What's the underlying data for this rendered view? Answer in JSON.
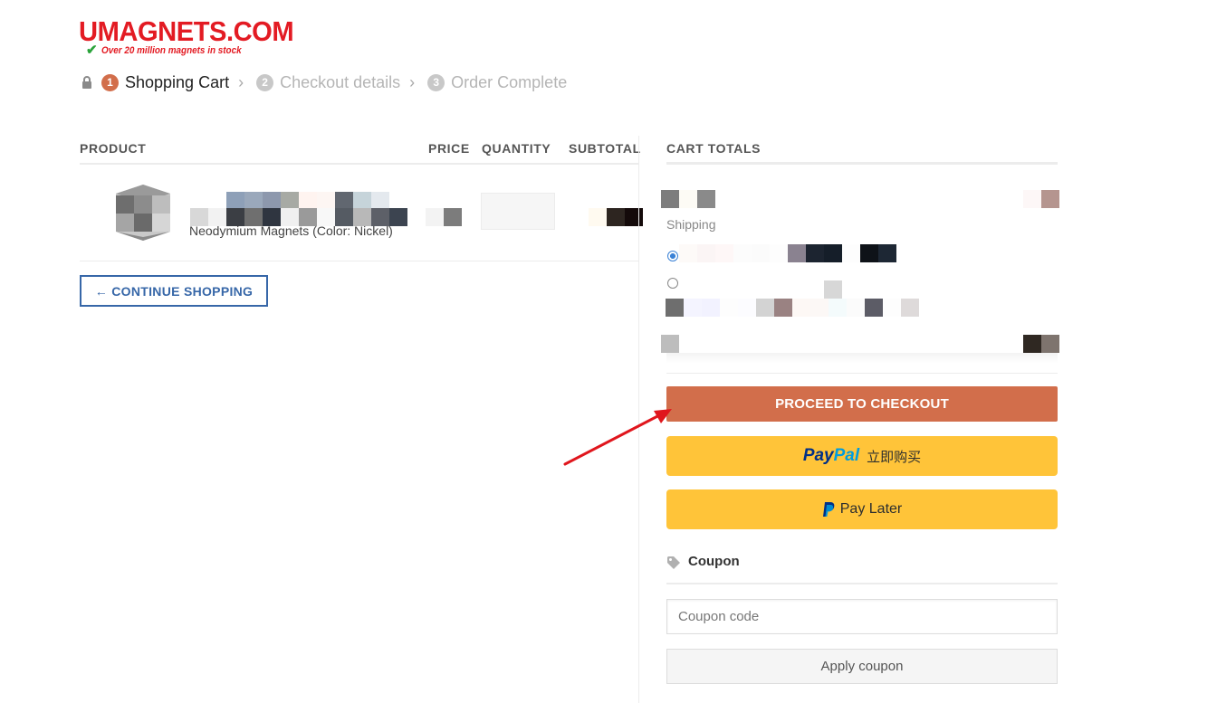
{
  "logo": {
    "name": "UMAGNETS.COM",
    "tagline": "Over 20 million magnets in stock"
  },
  "steps": [
    {
      "num": "1",
      "label": "Shopping Cart"
    },
    {
      "num": "2",
      "label": "Checkout details"
    },
    {
      "num": "3",
      "label": "Order Complete"
    }
  ],
  "table": {
    "headers": {
      "product": "PRODUCT",
      "price": "PRICE",
      "quantity": "QUANTITY",
      "subtotal": "SUBTOTAL"
    },
    "rows": [
      {
        "name": "Neodymium Magnets (Color: Nickel)"
      }
    ]
  },
  "continue_label": "← CONTINUE SHOPPING",
  "cart_totals": {
    "title": "CART TOTALS",
    "shipping_label": "Shipping",
    "checkout_label": "PROCEED TO CHECKOUT",
    "paypal": {
      "pay": "Pay",
      "pal": "Pal",
      "cn_label": "立即购买"
    },
    "pay_later_label": "Pay Later"
  },
  "coupon": {
    "title": "Coupon",
    "placeholder": "Coupon code",
    "apply_label": "Apply coupon"
  },
  "colors": {
    "accent": "#d26e4b",
    "link_blue": "#3767a8",
    "paypal_yellow": "#ffc439",
    "logo_red": "#e31b23",
    "annotation_arrow": "#e0161d"
  }
}
